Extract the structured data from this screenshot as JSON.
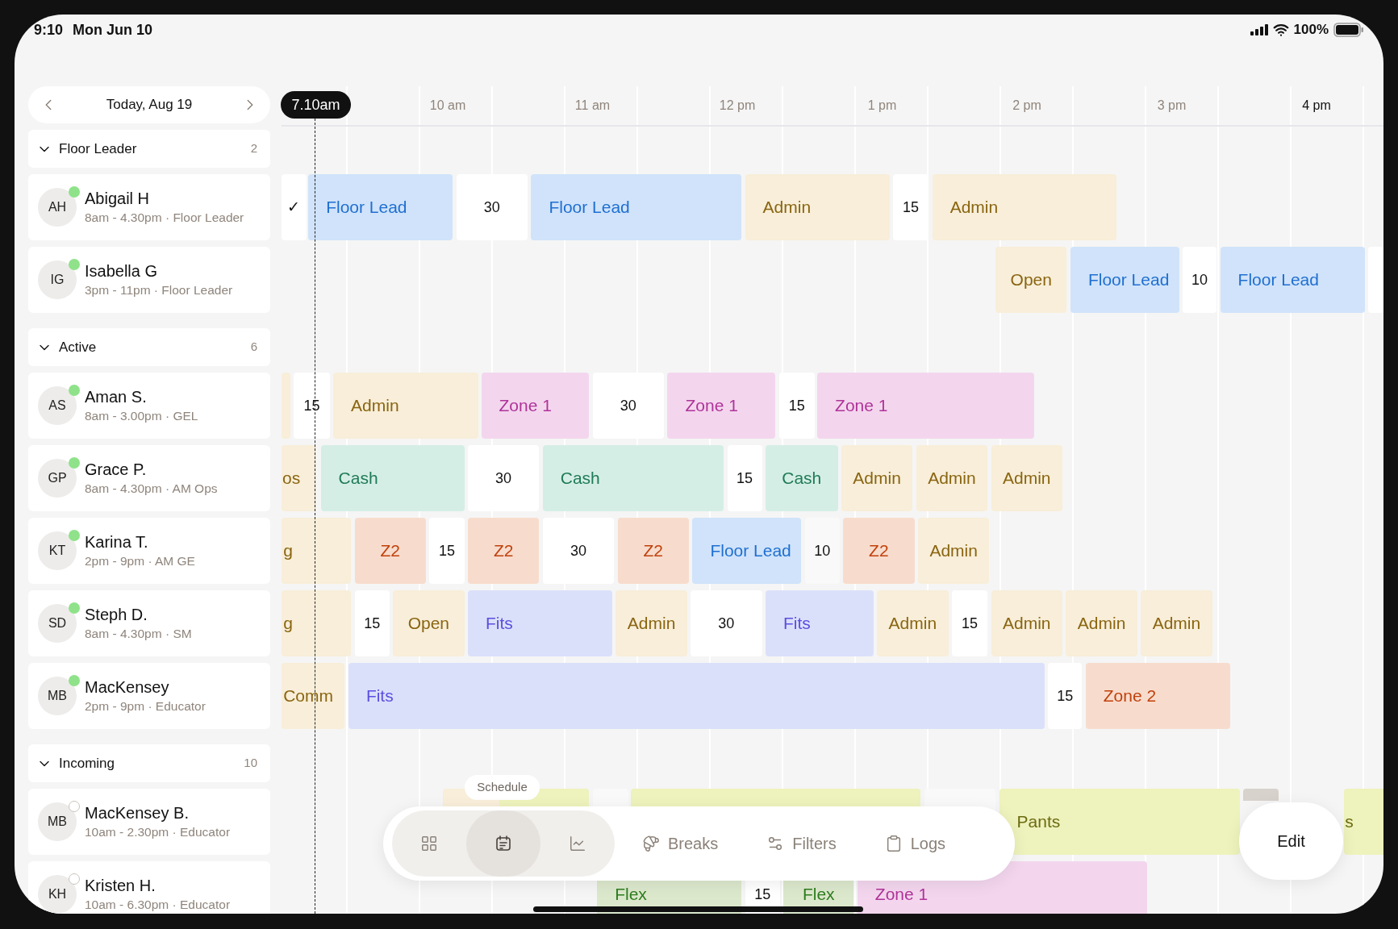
{
  "status_bar": {
    "time": "9:10",
    "date": "Mon Jun 10",
    "battery": "100%"
  },
  "date_nav": {
    "label": "Today, Aug 19"
  },
  "timeline": {
    "now": "7.10am",
    "hours": [
      {
        "label": "10 am",
        "highlighted": false
      },
      {
        "label": "11 am",
        "highlighted": false
      },
      {
        "label": "12 pm",
        "highlighted": false
      },
      {
        "label": "1 pm",
        "highlighted": false
      },
      {
        "label": "2 pm",
        "highlighted": false
      },
      {
        "label": "3 pm",
        "highlighted": false
      },
      {
        "label": "4 pm",
        "highlighted": true
      }
    ]
  },
  "groups": [
    {
      "title": "Floor Leader",
      "count": "2",
      "expanded": true,
      "people": [
        {
          "initials": "AH",
          "name": "Abigail H",
          "subtitle": "8am - 4.30pm · Floor Leader",
          "online": true,
          "blocks": [
            {
              "kind": "check",
              "label": "✓"
            },
            {
              "kind": "floor-lead",
              "label": "Floor Lead"
            },
            {
              "kind": "break",
              "label": "30"
            },
            {
              "kind": "floor-lead",
              "label": "Floor Lead"
            },
            {
              "kind": "admin",
              "label": "Admin"
            },
            {
              "kind": "break",
              "label": "15"
            },
            {
              "kind": "admin",
              "label": "Admin"
            }
          ]
        },
        {
          "initials": "IG",
          "name": "Isabella G",
          "subtitle": "3pm - 11pm · Floor Leader",
          "online": true,
          "blocks": [
            {
              "kind": "admin",
              "label": "Open"
            },
            {
              "kind": "floor-lead",
              "label": "Floor Lead"
            },
            {
              "kind": "break",
              "label": "10"
            },
            {
              "kind": "floor-lead",
              "label": "Floor Lead"
            },
            {
              "kind": "break"
            }
          ]
        }
      ]
    },
    {
      "title": "Active",
      "count": "6",
      "expanded": true,
      "people": [
        {
          "initials": "AS",
          "name": "Aman S.",
          "subtitle": "8am - 3.00pm · GEL",
          "online": true,
          "blocks": [
            {
              "kind": "admin"
            },
            {
              "kind": "break",
              "label": "15"
            },
            {
              "kind": "admin",
              "label": "Admin"
            },
            {
              "kind": "zone",
              "label": "Zone 1"
            },
            {
              "kind": "break",
              "label": "30"
            },
            {
              "kind": "zone",
              "label": "Zone 1"
            },
            {
              "kind": "break",
              "label": "15"
            },
            {
              "kind": "zone",
              "label": "Zone 1"
            }
          ]
        },
        {
          "initials": "GP",
          "name": "Grace P.",
          "subtitle": "8am - 4.30pm · AM Ops",
          "online": true,
          "blocks": [
            {
              "kind": "admin",
              "label": "os"
            },
            {
              "kind": "cash",
              "label": "Cash"
            },
            {
              "kind": "break",
              "label": "30"
            },
            {
              "kind": "cash",
              "label": "Cash"
            },
            {
              "kind": "break",
              "label": "15"
            },
            {
              "kind": "cash",
              "label": "Cash"
            },
            {
              "kind": "admin",
              "label": "Admin"
            },
            {
              "kind": "admin",
              "label": "Admin"
            },
            {
              "kind": "admin",
              "label": "Admin"
            }
          ]
        },
        {
          "initials": "KT",
          "name": "Karina T.",
          "subtitle": "2pm - 9pm · AM GE",
          "online": true,
          "blocks": [
            {
              "kind": "admin",
              "label": "g"
            },
            {
              "kind": "z2",
              "label": "Z2"
            },
            {
              "kind": "break",
              "label": "15"
            },
            {
              "kind": "z2",
              "label": "Z2"
            },
            {
              "kind": "break",
              "label": "30"
            },
            {
              "kind": "z2",
              "label": "Z2"
            },
            {
              "kind": "floor-lead",
              "label": "Floor Lead"
            },
            {
              "kind": "gap",
              "label": "10"
            },
            {
              "kind": "z2",
              "label": "Z2"
            },
            {
              "kind": "admin",
              "label": "Admin"
            }
          ]
        },
        {
          "initials": "SD",
          "name": "Steph D.",
          "subtitle": "8am - 4.30pm · SM",
          "online": true,
          "blocks": [
            {
              "kind": "admin",
              "label": "g"
            },
            {
              "kind": "break",
              "label": "15"
            },
            {
              "kind": "admin",
              "label": "Open"
            },
            {
              "kind": "fits",
              "label": "Fits"
            },
            {
              "kind": "admin",
              "label": "Admin"
            },
            {
              "kind": "break",
              "label": "30"
            },
            {
              "kind": "fits",
              "label": "Fits"
            },
            {
              "kind": "admin",
              "label": "Admin"
            },
            {
              "kind": "break",
              "label": "15"
            },
            {
              "kind": "admin",
              "label": "Admin"
            },
            {
              "kind": "admin",
              "label": "Admin"
            },
            {
              "kind": "admin",
              "label": "Admin"
            }
          ]
        },
        {
          "initials": "MB",
          "name": "MacKensey",
          "subtitle": "2pm - 9pm · Educator",
          "online": true,
          "blocks": [
            {
              "kind": "admin",
              "label": "Comm"
            },
            {
              "kind": "fits",
              "label": "Fits"
            },
            {
              "kind": "break",
              "label": "15"
            },
            {
              "kind": "z2",
              "label": "Zone 2"
            }
          ]
        }
      ]
    },
    {
      "title": "Incoming",
      "count": "10",
      "expanded": true,
      "people": [
        {
          "initials": "MB",
          "name": "MacKensey B.",
          "subtitle": "10am - 2.30pm · Educator",
          "online": false,
          "blocks": [
            {
              "kind": "admin"
            },
            {
              "kind": "pants"
            },
            {
              "kind": "gap"
            },
            {
              "kind": "pants"
            },
            {
              "kind": "gap"
            },
            {
              "kind": "pants",
              "label": "Pants"
            },
            {
              "kind": "hold"
            },
            {
              "kind": "pants",
              "label": "s"
            }
          ]
        },
        {
          "initials": "KH",
          "name": "Kristen H.",
          "subtitle": "10am - 6.30pm · Educator",
          "online": false,
          "blocks": [
            {
              "kind": "flex",
              "label": "Flex"
            },
            {
              "kind": "break",
              "label": "15"
            },
            {
              "kind": "flex",
              "label": "Flex"
            },
            {
              "kind": "zone",
              "label": "Zone 1"
            }
          ]
        }
      ]
    }
  ],
  "bottom_nav": {
    "tooltip": "Schedule",
    "views": [
      {
        "selected": false
      },
      {
        "selected": true
      },
      {
        "selected": false
      }
    ],
    "actions": [
      "Breaks",
      "Filters",
      "Logs"
    ],
    "edit": "Edit"
  }
}
